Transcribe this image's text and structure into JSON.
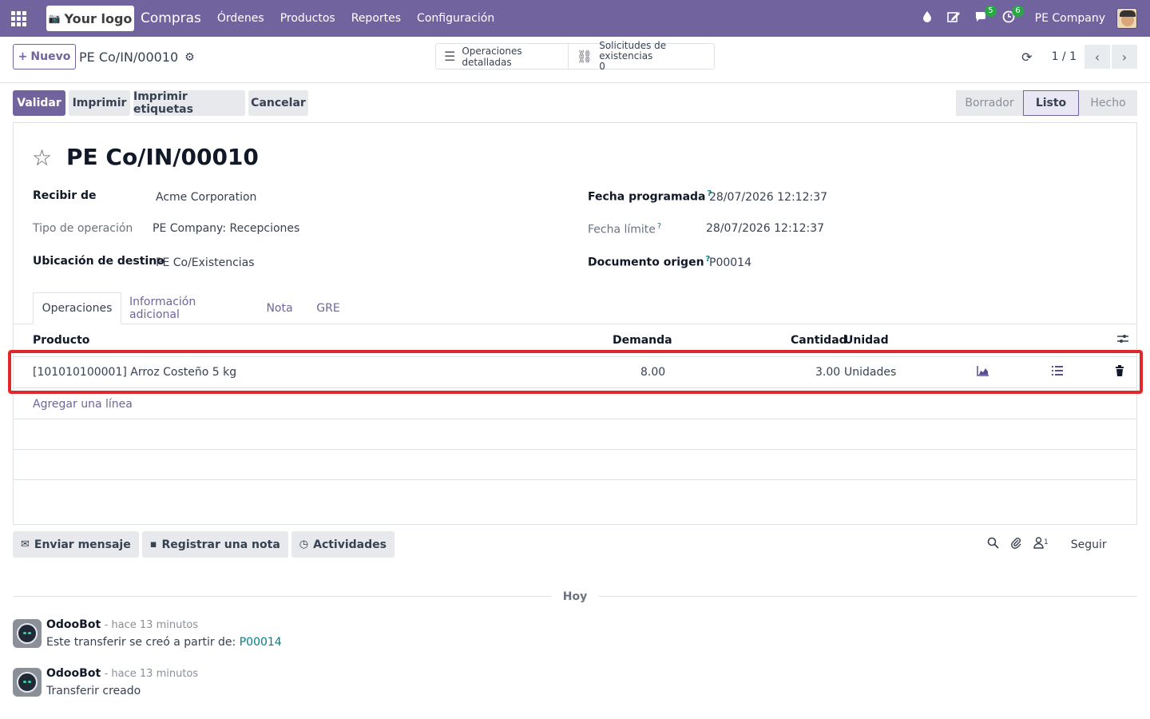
{
  "navbar": {
    "logo_text": "Your logo",
    "app_name": "Compras",
    "menu": [
      "Órdenes",
      "Productos",
      "Reportes",
      "Configuración"
    ],
    "messages_count": "5",
    "activities_count": "6",
    "company": "PE Company"
  },
  "control": {
    "new_label": "Nuevo",
    "breadcrumb": "PE Co/IN/00010",
    "smart_ops": "Operaciones detalladas",
    "smart_stock_label": "Solicitudes de existencias",
    "smart_stock_count": "0",
    "pager": "1 / 1"
  },
  "status": {
    "validate": "Validar",
    "print": "Imprimir",
    "print_labels": "Imprimir etiquetas",
    "cancel": "Cancelar",
    "stages": [
      "Borrador",
      "Listo",
      "Hecho"
    ],
    "active_stage": "Listo"
  },
  "record": {
    "title": "PE Co/IN/00010",
    "receive_from_label": "Recibir de",
    "receive_from": "Acme Corporation",
    "op_type_label": "Tipo de operación",
    "op_type": "PE Company: Recepciones",
    "dest_label": "Ubicación de destino",
    "dest": "PE Co/Existencias",
    "scheduled_label": "Fecha programada",
    "scheduled": "28/07/2026 12:12:37",
    "deadline_label": "Fecha límite",
    "deadline": "28/07/2026 12:12:37",
    "origin_label": "Documento origen",
    "origin": "P00014"
  },
  "tabs": [
    "Operaciones",
    "Información adicional",
    "Nota",
    "GRE"
  ],
  "table": {
    "headers": {
      "product": "Producto",
      "demand": "Demanda",
      "quantity": "Cantidad",
      "unit": "Unidad"
    },
    "rows": [
      {
        "product": "[101010100001] Arroz Costeño 5 kg",
        "demand": "8.00",
        "quantity": "3.00",
        "unit": "Unidades"
      }
    ],
    "add_line": "Agregar una línea"
  },
  "chatter": {
    "send_message": "Enviar mensaje",
    "log_note": "Registrar una nota",
    "activities": "Actividades",
    "followers_count": "1",
    "follow": "Seguir",
    "today": "Hoy",
    "messages": [
      {
        "author": "OdooBot",
        "time": "- hace 13 minutos",
        "body": "Este transferir se creó a partir de: ",
        "link": "P00014"
      },
      {
        "author": "OdooBot",
        "time": "- hace 13 minutos",
        "body": "Transferir creado"
      }
    ]
  },
  "colors": {
    "brand": "#71639e",
    "highlight": "#e0282a",
    "badge": "#28a745"
  }
}
